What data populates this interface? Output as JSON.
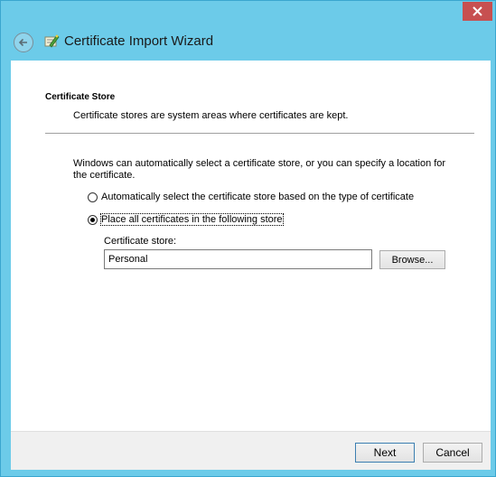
{
  "window": {
    "title": "Certificate Import Wizard",
    "close_icon": "close-icon",
    "back_icon": "back-arrow-icon",
    "app_icon": "certificate-wizard-icon",
    "accent_color": "#6ccbe9",
    "close_color": "#c75050"
  },
  "section": {
    "title": "Certificate Store",
    "description": "Certificate stores are system areas where certificates are kept."
  },
  "body": {
    "intro": "Windows can automatically select a certificate store, or you can specify a location for the certificate.",
    "options": [
      {
        "label": "Automatically select the certificate store based on the type of certificate",
        "selected": false
      },
      {
        "label": "Place all certificates in the following store",
        "selected": true
      }
    ],
    "store_label": "Certificate store:",
    "store_value": "Personal",
    "browse_label": "Browse..."
  },
  "footer": {
    "next_label": "Next",
    "cancel_label": "Cancel"
  }
}
